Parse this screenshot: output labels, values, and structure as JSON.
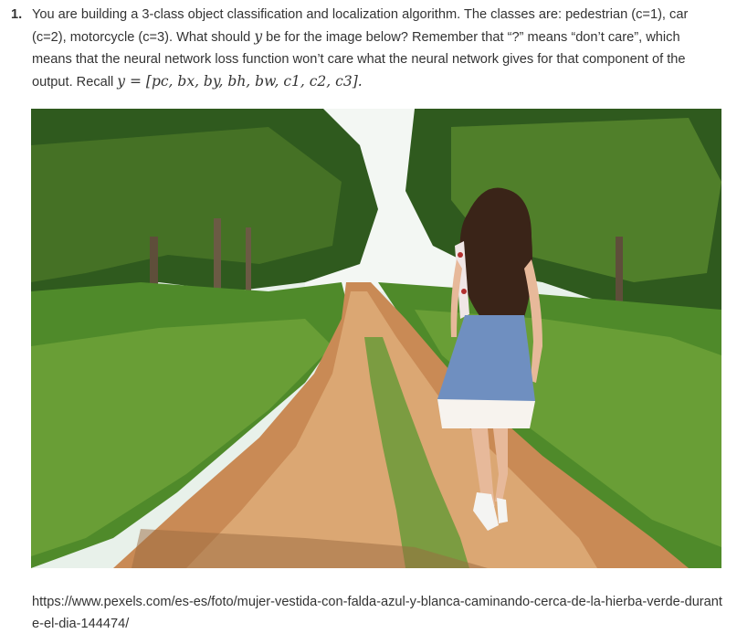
{
  "question": {
    "number": "1.",
    "text_before_y": "You are building a 3-class object classification and localization algorithm. The classes are: pedestrian (c=1), car (c=2), motorcycle (c=3). What should ",
    "y_symbol": "y",
    "text_after_y": " be for the image below? Remember that “?” means “don’t care”, which means that the neural network loss function won’t care what the neural network gives for that component of the output. Recall ",
    "recall_formula": "y = [pc, bx, by, bh, bw, c1, c2, c3]."
  },
  "image": {
    "colors": {
      "sky": "#e8f1ea",
      "foliage_dark": "#2f5a1e",
      "foliage_mid": "#5e8f2f",
      "grass": "#6fa23a",
      "path": "#c98a55",
      "path_light": "#e0b07e",
      "hair": "#3a2418",
      "skirt": "#6f8fc0",
      "skin": "#e7b99a"
    }
  },
  "source_url": "https://www.pexels.com/es-es/foto/mujer-vestida-con-falda-azul-y-blanca-caminando-cerca-de-la-hierba-verde-durante-el-dia-144474/"
}
